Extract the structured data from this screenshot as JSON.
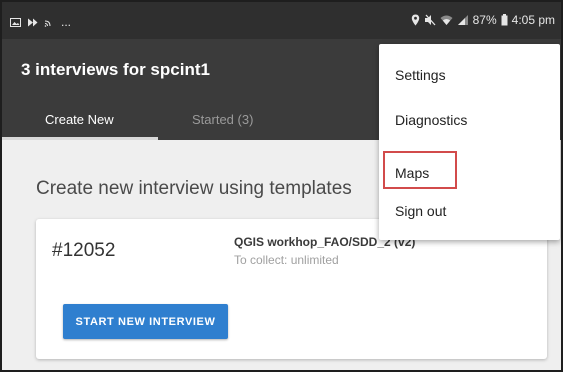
{
  "statusbar": {
    "battery": "87%",
    "time": "4:05 pm",
    "left_icons": [
      "image-icon",
      "play-icon",
      "cast-icon"
    ],
    "right_icons": [
      "location-icon",
      "mute-icon",
      "wifi-icon",
      "signal-icon",
      "battery-icon"
    ],
    "more_label": "..."
  },
  "appbar": {
    "title": "3 interviews for spcint1",
    "tabs": [
      {
        "label": "Create New",
        "active": true
      },
      {
        "label": "Started (3)",
        "active": false
      }
    ]
  },
  "main": {
    "section_title": "Create new interview using templates",
    "card": {
      "id": "#12052",
      "name": "QGIS workhop_FAO/SDD_2 (v2)",
      "collect": "To collect: unlimited",
      "button_label": "START NEW INTERVIEW"
    }
  },
  "menu": {
    "items": [
      {
        "label": "Settings"
      },
      {
        "label": "Diagnostics"
      },
      {
        "label": "Maps",
        "highlighted": true
      },
      {
        "label": "Sign out"
      }
    ]
  },
  "colors": {
    "statusbar": "#2f2f2f",
    "appbar": "#3b3b3b",
    "content": "#efefef",
    "button": "#2f7fcf",
    "highlight": "#d24b4b"
  }
}
